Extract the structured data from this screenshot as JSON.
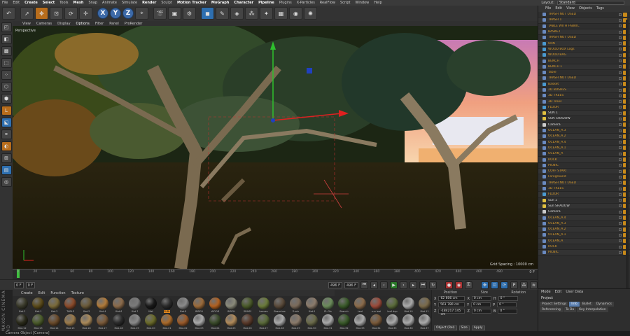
{
  "menubar": {
    "items": [
      "File",
      "Edit",
      "Create",
      "Select",
      "Tools",
      "Mesh",
      "Snap",
      "Animate",
      "Simulate",
      "Render",
      "Sculpt",
      "Motion Tracker",
      "MoGraph",
      "Character",
      "Pipeline",
      "Plugins",
      "X-Particles",
      "RealFlow",
      "Script",
      "Window",
      "Help"
    ],
    "layout_label": "Layout:",
    "layout_value": "Standard"
  },
  "toolbar": {
    "axis_buttons": [
      "X",
      "Y",
      "Z"
    ]
  },
  "viewport": {
    "menu": [
      "View",
      "Cameras",
      "Display",
      "Options",
      "Filter",
      "Panel",
      "ProRender"
    ],
    "view_name": "Perspective",
    "grid_spacing": "Grid Spacing : 10000 cm"
  },
  "timeline": {
    "ticks": [
      "0",
      "20",
      "40",
      "60",
      "80",
      "100",
      "120",
      "140",
      "160",
      "180",
      "200",
      "220",
      "240",
      "260",
      "280",
      "300",
      "320",
      "340",
      "360",
      "380",
      "400",
      "420",
      "440",
      "460",
      "480"
    ],
    "end_frame": "0 F"
  },
  "transport": {
    "start_field": "0 F",
    "current_field": "0 F",
    "end_field": "496 F",
    "end_field2": "496 F"
  },
  "material_manager": {
    "menu": [
      "Create",
      "Edit",
      "Function",
      "Texture"
    ],
    "materials": [
      {
        "label": "Mat.3",
        "color": "#3a3a2a"
      },
      {
        "label": "Mat.1",
        "color": "#5a4a1a"
      },
      {
        "label": "Mat.2",
        "color": "#7a6a3a"
      },
      {
        "label": "TABLE",
        "color": "#8a4a2a"
      },
      {
        "label": "Mat.5",
        "color": "#6a5a3a"
      },
      {
        "label": "Mat.4",
        "color": "#b07a3a"
      },
      {
        "label": "Mat.6",
        "color": "#8a6a4a"
      },
      {
        "label": "Mat.7",
        "color": "#7a7a7a"
      },
      {
        "label": "Mat",
        "color": "#1a1a1a"
      },
      {
        "label": "CURL",
        "color": "#2a2a2a"
      },
      {
        "label": "Mat.8",
        "color": "#8a8a8a"
      },
      {
        "label": "BIRCH",
        "color": "#9a6a3a"
      },
      {
        "label": "WOOD",
        "color": "#b06020"
      },
      {
        "label": "BIRCH",
        "color": "#8a8a7a"
      },
      {
        "label": "GRASS",
        "color": "#4a5a2a"
      },
      {
        "label": "Leaves",
        "color": "#6a7a3a"
      },
      {
        "label": "Branches",
        "color": "#5a4a3a"
      },
      {
        "label": "Trunk",
        "color": "#7a6a5a"
      },
      {
        "label": "Mat.9",
        "color": "#8a7a6a"
      },
      {
        "label": "PL.Gls",
        "color": "#6a8a5a"
      },
      {
        "label": "Branch",
        "color": "#3a5a2a"
      },
      {
        "label": "Leaf",
        "color": "#8a6a4a"
      },
      {
        "label": "sun leaf",
        "color": "#9a4a3a"
      },
      {
        "label": "leaf dup",
        "color": "#5a6a3a"
      },
      {
        "label": "Mat.10",
        "color": "#aaaaaa"
      },
      {
        "label": "Mat.11",
        "color": "#7a6a4a"
      },
      {
        "label": "Mat.12",
        "color": "#2a2a1a"
      },
      {
        "label": "Mat.13",
        "color": "#4a5a2a"
      },
      {
        "label": "Mat.14",
        "color": "#6a4a2a"
      },
      {
        "label": "Mat.15",
        "color": "#9a7a4a"
      },
      {
        "label": "Mat.16",
        "color": "#aa8a5a"
      },
      {
        "label": "Mat.17",
        "color": "#7a5a3a"
      },
      {
        "label": "Mat.18",
        "color": "#2a2a2a"
      },
      {
        "label": "Mat.19",
        "color": "#8a8a8a"
      },
      {
        "label": "Mat.20",
        "color": "#6a6a2a"
      },
      {
        "label": "Mat.21",
        "color": "#aa6a2a"
      },
      {
        "label": "Mat.22",
        "color": "#9a5a2a"
      },
      {
        "label": "Mat.23",
        "color": "#aaaaaa"
      },
      {
        "label": "Mat.24",
        "color": "#3a4a2a"
      },
      {
        "label": "Mat.25",
        "color": "#b08a5a"
      },
      {
        "label": "Mat.26",
        "color": "#5a3a2a"
      },
      {
        "label": "Mat.27",
        "color": "#5a6a3a"
      },
      {
        "label": "Mat.28",
        "color": "#aaaaaa"
      },
      {
        "label": "Mat.29",
        "color": "#8a7a6a"
      },
      {
        "label": "Mat.30",
        "color": "#6a6a4a"
      },
      {
        "label": "Mat.31",
        "color": "#aaaaaa"
      },
      {
        "label": "Mat.32",
        "color": "#3a5a2a"
      },
      {
        "label": "Mat.33",
        "color": "#aaaaaa"
      },
      {
        "label": "Mat.34",
        "color": "#7a5a3a"
      },
      {
        "label": "Mat.35",
        "color": "#aaaaaa"
      },
      {
        "label": "Mat.36",
        "color": "#aaaaaa"
      },
      {
        "label": "Mat.37",
        "color": "#aaaaaa"
      }
    ],
    "selected_index": 9
  },
  "coordinates": {
    "headers": [
      "Position",
      "Size",
      "Rotation"
    ],
    "rows": [
      {
        "axis": "X",
        "pos": "62 606 cm",
        "axis2": "X",
        "size": "0 cm",
        "axis3": "H",
        "rot": "0 °"
      },
      {
        "axis": "Y",
        "pos": "561 780 cm",
        "axis2": "Y",
        "size": "0 cm",
        "axis3": "P",
        "rot": "0 °"
      },
      {
        "axis": "Z",
        "pos": "-184217.145 cm",
        "axis2": "Z",
        "size": "0 cm",
        "axis3": "B",
        "rot": "0 °"
      }
    ],
    "mode": "Object (Rel)",
    "size_mode": "Size",
    "apply": "Apply"
  },
  "object_manager": {
    "tabs": [
      "File",
      "Edit",
      "View",
      "Objects",
      "Tags"
    ],
    "items": [
      {
        "name": "TRASH NOT USED",
        "type": "null"
      },
      {
        "name": "TRASH 1",
        "type": "null"
      },
      {
        "name": "TABLE WITH FABRIC",
        "type": "null"
      },
      {
        "name": "BASKET",
        "type": "null"
      },
      {
        "name": "TRASH NOT USED",
        "type": "null"
      },
      {
        "name": "URN",
        "type": "obj"
      },
      {
        "name": "WOOD BOX Logs",
        "type": "obj"
      },
      {
        "name": "WOOD BAG",
        "type": "obj"
      },
      {
        "name": "BENCH",
        "type": "null"
      },
      {
        "name": "BENCH 1",
        "type": "null"
      },
      {
        "name": "Table",
        "type": "null"
      },
      {
        "name": "TRASH NOT USED",
        "type": "null"
      },
      {
        "name": "Basket",
        "type": "obj"
      },
      {
        "name": "2D BUSHES",
        "type": "null"
      },
      {
        "name": "3D TREES",
        "type": "null"
      },
      {
        "name": "3D Trees",
        "type": "null"
      },
      {
        "name": "FLOOR",
        "type": "obj"
      },
      {
        "name": "SUN 1",
        "type": "light"
      },
      {
        "name": "SUN SHADOW",
        "type": "light"
      },
      {
        "name": "Camera",
        "type": "cam"
      },
      {
        "name": "OCEAN_A.3",
        "type": "null"
      },
      {
        "name": "OCEAN_A.2",
        "type": "null"
      },
      {
        "name": "OCEAN_A.4",
        "type": "null"
      },
      {
        "name": "OCEAN_A.1",
        "type": "null"
      },
      {
        "name": "OCEAN_A",
        "type": "null"
      },
      {
        "name": "ROCK",
        "type": "null"
      },
      {
        "name": "PICNIC",
        "type": "null"
      },
      {
        "name": "COFF START",
        "type": "null"
      },
      {
        "name": "Foreground",
        "type": "null"
      },
      {
        "name": "TRASH NOT USED",
        "type": "null"
      },
      {
        "name": "3D TREES",
        "type": "null"
      },
      {
        "name": "FLOOR",
        "type": "obj"
      },
      {
        "name": "Sun 1",
        "type": "light"
      },
      {
        "name": "Sun SHADOW",
        "type": "light"
      },
      {
        "name": "Camera",
        "type": "cam"
      },
      {
        "name": "OCEAN_A.4",
        "type": "null"
      },
      {
        "name": "OCEAN_A.3",
        "type": "null"
      },
      {
        "name": "OCEAN_A.2",
        "type": "null"
      },
      {
        "name": "OCEAN_A.1",
        "type": "null"
      },
      {
        "name": "OCEAN_A",
        "type": "null"
      },
      {
        "name": "ROCK",
        "type": "null"
      },
      {
        "name": "PICNIC",
        "type": "null"
      }
    ]
  },
  "attributes": {
    "menu": [
      "Mode",
      "Edit",
      "User Data"
    ],
    "title": "Project",
    "tabs": [
      "Project Settings",
      "Info",
      "Bullet",
      "Dynamics",
      "Referencing",
      "To Do",
      "Key Interpolation"
    ],
    "active_tab": 1
  },
  "status": "Camera Object [Camera]",
  "maxon_label": "MAXON CINEMA 4D"
}
